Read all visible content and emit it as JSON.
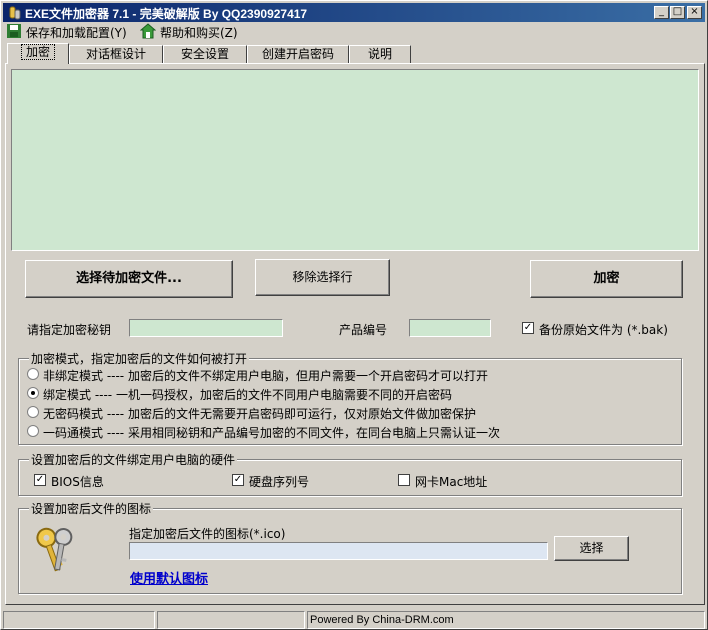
{
  "window": {
    "title": "EXE文件加密器 7.1 - 完美破解版 By QQ2390927417",
    "controls": {
      "minimize": "_",
      "maximize": "□",
      "close": "×"
    }
  },
  "menu": {
    "items": [
      {
        "label": "保存和加载配置(Y)",
        "icon": "save-icon"
      },
      {
        "label": "帮助和购买(Z)",
        "icon": "help-icon"
      }
    ]
  },
  "tabs": [
    {
      "label": "加密",
      "active": true
    },
    {
      "label": "对话框设计",
      "active": false
    },
    {
      "label": "安全设置",
      "active": false
    },
    {
      "label": "创建开启密码",
      "active": false
    },
    {
      "label": "说明",
      "active": false
    }
  ],
  "file_list": {
    "background": "#cee7d0",
    "items": []
  },
  "buttons": {
    "select_file": "选择待加密文件...",
    "remove_selected": "移除选择行",
    "encrypt": "加密"
  },
  "key_row": {
    "key_label": "请指定加密秘钥",
    "key_value": "",
    "product_label": "产品编号",
    "product_value": "",
    "backup_label": "备份原始文件为 (*.bak)",
    "backup_checked": true,
    "field_color": "#cee7d0"
  },
  "mode_group": {
    "title": "加密模式，指定加密后的文件如何被打开",
    "options": [
      {
        "label": "非绑定模式 ---- 加密后的文件不绑定用户电脑，但用户需要一个开启密码才可以打开",
        "selected": false
      },
      {
        "label": "绑定模式 ---- 一机一码授权，加密后的文件不同用户电脑需要不同的开启密码",
        "selected": true
      },
      {
        "label": "无密码模式 ---- 加密后的文件无需要开启密码即可运行，仅对原始文件做加密保护",
        "selected": false
      },
      {
        "label": "一码通模式 ---- 采用相同秘钥和产品编号加密的不同文件，在同台电脑上只需认证一次",
        "selected": false
      }
    ]
  },
  "hardware_group": {
    "title": "设置加密后的文件绑定用户电脑的硬件",
    "options": [
      {
        "label": "BIOS信息",
        "checked": true
      },
      {
        "label": "硬盘序列号",
        "checked": true
      },
      {
        "label": "网卡Mac地址",
        "checked": false
      }
    ]
  },
  "icon_group": {
    "title": "设置加密后文件的图标",
    "prompt": "指定加密后文件的图标(*.ico)",
    "path_value": "",
    "path_color": "#dde6f2",
    "browse_label": "选择",
    "default_link": "使用默认图标",
    "preview_icon": "keys-icon"
  },
  "status": {
    "panes": [
      "",
      "",
      "Powered By China-DRM.com"
    ]
  }
}
